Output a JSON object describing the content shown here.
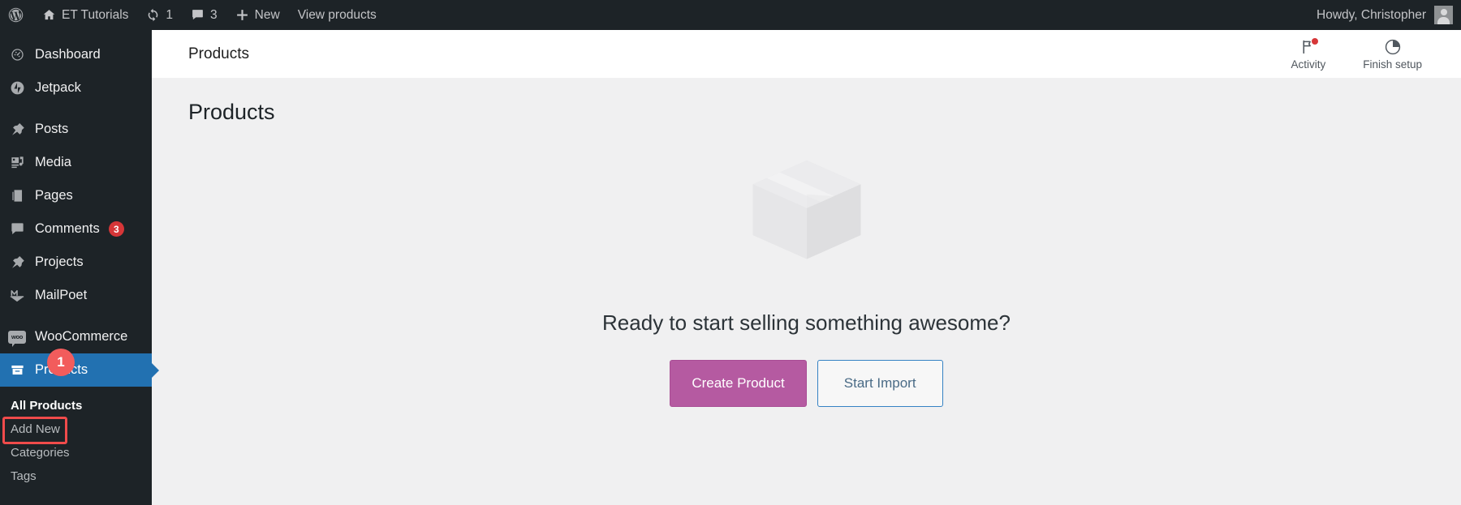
{
  "adminbar": {
    "logo_icon": "wordpress-logo-icon",
    "site": {
      "icon": "home-icon",
      "label": "ET Tutorials"
    },
    "updates": {
      "icon": "updates-icon",
      "count": "1"
    },
    "comments": {
      "icon": "comment-bubble-icon",
      "count": "3"
    },
    "new": {
      "icon": "plus-icon",
      "label": "New"
    },
    "view_products": "View products",
    "howdy": "Howdy, Christopher",
    "avatar_icon": "user-avatar-icon"
  },
  "sidebar": {
    "items": [
      {
        "label": "Dashboard",
        "icon": "dashboard-icon"
      },
      {
        "label": "Jetpack",
        "icon": "jetpack-icon"
      },
      {
        "label": "Posts",
        "icon": "pin-icon"
      },
      {
        "label": "Media",
        "icon": "media-icon"
      },
      {
        "label": "Pages",
        "icon": "pages-icon"
      },
      {
        "label": "Comments",
        "icon": "comment-icon",
        "badge": "3"
      },
      {
        "label": "Projects",
        "icon": "pin-icon"
      },
      {
        "label": "MailPoet",
        "icon": "mailpoet-icon"
      },
      {
        "label": "WooCommerce",
        "icon": "woocommerce-icon"
      },
      {
        "label": "Products",
        "icon": "products-icon",
        "current": true
      }
    ],
    "submenu": [
      {
        "label": "All Products",
        "current": true
      },
      {
        "label": "Add New",
        "annotated": true
      },
      {
        "label": "Categories"
      },
      {
        "label": "Tags"
      }
    ],
    "step_badge": "1"
  },
  "header": {
    "title": "Products",
    "activity": {
      "label": "Activity",
      "icon": "flag-icon"
    },
    "finish_setup": {
      "label": "Finish setup",
      "icon": "pie-progress-icon"
    }
  },
  "main": {
    "page_title": "Products",
    "illustration": "package-box-icon",
    "empty_heading": "Ready to start selling something awesome?",
    "create_product_label": "Create Product",
    "start_import_label": "Start Import"
  },
  "colors": {
    "admin_dark": "#1d2327",
    "current_blue": "#2271b1",
    "badge_red": "#d63638",
    "annotation_red": "#f04b4b",
    "purple_button": "#b55aa1",
    "import_border": "#3582c4"
  }
}
